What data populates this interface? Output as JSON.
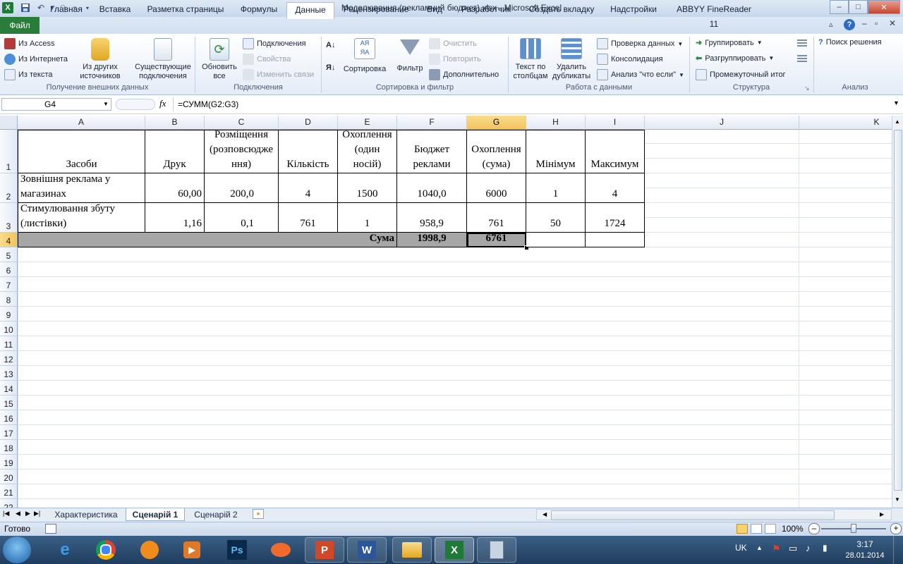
{
  "window": {
    "title": "Моделювання (рекламний бюджет).xlsx  -  Microsoft Excel",
    "excel_icon": "excel-icon",
    "save_icon": "save-icon",
    "undo_icon": "undo-icon",
    "redo_icon": "redo-icon",
    "minimize": "–",
    "maximize": "□",
    "close": "✕"
  },
  "ribbon": {
    "file_tab": "Файл",
    "tabs": [
      "Главная",
      "Вставка",
      "Разметка страницы",
      "Формулы",
      "Данные",
      "Рецензирование",
      "Вид",
      "Разработчик",
      "Создать вкладку",
      "Надстройки",
      "ABBYY FineReader 11"
    ],
    "active_tab": "Данные",
    "groups": {
      "external": {
        "label": "Получение внешних данных",
        "from_access": "Из Access",
        "from_web": "Из Интернета",
        "from_text": "Из текста",
        "from_other": "Из других источников",
        "existing": "Существующие подключения"
      },
      "connections": {
        "label": "Подключения",
        "refresh": "Обновить все",
        "connections": "Подключения",
        "properties": "Свойства",
        "edit_links": "Изменить связи"
      },
      "sort_filter": {
        "label": "Сортировка и фильтр",
        "sort": "Сортировка",
        "filter": "Фильтр",
        "clear": "Очистить",
        "reapply": "Повторить",
        "advanced": "Дополнительно"
      },
      "data_tools": {
        "label": "Работа с данными",
        "text_to_columns": "Текст по столбцам",
        "remove_duplicates": "Удалить дубликаты",
        "validation": "Проверка данных",
        "consolidate": "Консолидация",
        "whatif": "Анализ \"что если\""
      },
      "outline": {
        "label": "Структура",
        "group": "Группировать",
        "ungroup": "Разгруппировать",
        "subtotal": "Промежуточный итог"
      },
      "analysis": {
        "label": "Анализ",
        "solver": "Поиск решения"
      }
    }
  },
  "formula_bar": {
    "name_box": "G4",
    "fx": "fx",
    "formula": "=СУММ(G2:G3)"
  },
  "sheet": {
    "columns": [
      "A",
      "B",
      "C",
      "D",
      "E",
      "F",
      "G",
      "H",
      "I",
      "J",
      "K"
    ],
    "rows": [
      "1",
      "2",
      "3",
      "4",
      "5",
      "6",
      "7",
      "8",
      "9",
      "10",
      "11",
      "12",
      "13",
      "14",
      "15",
      "16",
      "17",
      "18",
      "19",
      "20",
      "21",
      "22"
    ],
    "header_row": [
      "Засоби",
      "Друк",
      "Розміщення (розповсюдження)",
      "Кількість",
      "Охоплення (один носій)",
      "Бюджет реклами",
      "Охоплення (сума)",
      "Мінімум",
      "Максимум"
    ],
    "header_lines": {
      "c": [
        "Розміщення",
        "(розповсюдже",
        "ння)"
      ],
      "e": [
        "Охоплення",
        "(один",
        "носій)"
      ],
      "f": [
        "Бюджет",
        "реклами"
      ],
      "g": [
        "Охоплення",
        "(сума)"
      ]
    },
    "data": [
      {
        "a_lines": [
          "Зовнішня реклама у",
          "магазинах"
        ],
        "b": "60,00",
        "c": "200,0",
        "d": "4",
        "e": "1500",
        "f": "1040,0",
        "g": "6000",
        "h": "1",
        "i": "4"
      },
      {
        "a_lines": [
          "Стимулювання збуту",
          "(листівки)"
        ],
        "b": "1,16",
        "c": "0,1",
        "d": "761",
        "e": "1",
        "f": "958,9",
        "g": "761",
        "h": "50",
        "i": "1724"
      }
    ],
    "total": {
      "label": "Сума",
      "f": "1998,9",
      "g": "6761"
    },
    "selected_cell": "G4"
  },
  "sheet_tabs": {
    "tabs": [
      "Характеристика",
      "Сценарій 1",
      "Сценарій 2"
    ],
    "active": "Сценарій 1"
  },
  "status_bar": {
    "ready": "Готово",
    "zoom": "100%"
  },
  "taskbar": {
    "apps": [
      "start",
      "ie",
      "chrome",
      "avast",
      "media",
      "photoshop",
      "fixer",
      "powerpoint",
      "word",
      "explorer",
      "excel",
      "calculator"
    ],
    "lang": "UK",
    "time": "3:17",
    "date": "28.01.2014"
  }
}
